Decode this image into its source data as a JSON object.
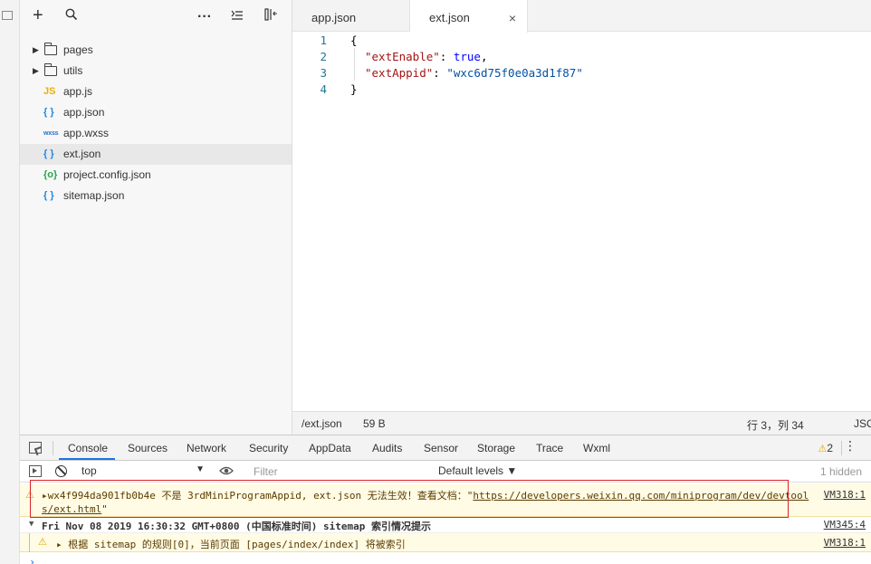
{
  "tree": {
    "toolbar": {
      "add_icon": "plus-icon",
      "search_icon": "search-icon",
      "more_icon": "ellipsis-icon",
      "collapse_icon": "list-collapse-icon",
      "layout_icon": "layout-icon"
    },
    "items": [
      {
        "label": "pages",
        "type": "folder"
      },
      {
        "label": "utils",
        "type": "folder"
      },
      {
        "label": "app.js",
        "type": "js",
        "icon": "JS"
      },
      {
        "label": "app.json",
        "type": "json",
        "icon": "{ }"
      },
      {
        "label": "app.wxss",
        "type": "wxss",
        "icon": "wxss"
      },
      {
        "label": "ext.json",
        "type": "json",
        "icon": "{ }",
        "selected": true
      },
      {
        "label": "project.config.json",
        "type": "config",
        "icon": "{o}"
      },
      {
        "label": "sitemap.json",
        "type": "json",
        "icon": "{ }"
      }
    ]
  },
  "editor": {
    "tabs": [
      {
        "label": "app.json"
      },
      {
        "label": "ext.json",
        "active": true,
        "close": "×"
      }
    ],
    "lines": [
      {
        "n": "1",
        "text": "{"
      },
      {
        "n": "2",
        "key": "\"extEnable\"",
        "sep": ": ",
        "val": "true",
        "end": ","
      },
      {
        "n": "3",
        "key": "\"extAppid\"",
        "sep": ": ",
        "val": "\"wxc6d75f0e0a3d1f87\"",
        "end": ""
      },
      {
        "n": "4",
        "text": "}"
      }
    ],
    "status": {
      "path": "/ext.json",
      "size": "59 B",
      "position": "行 3，列 34",
      "lang": "JSON"
    }
  },
  "devtools": {
    "tabs": [
      "Console",
      "Sources",
      "Network",
      "Security",
      "AppData",
      "Audits",
      "Sensor",
      "Storage",
      "Trace",
      "Wxml"
    ],
    "active_tab": "Console",
    "warning_count": "2",
    "context": "top",
    "filter_placeholder": "Filter",
    "levels": "Default levels ▼",
    "hidden": "1 hidden",
    "messages": [
      {
        "text_prefix": "▸wx4f994da901fb0b4e 不是 3rdMiniProgramAppid, ext.json 无法生效！查看文档：\"",
        "link": "https://developers.weixin.qq.com/miniprogram/dev/devtools/ext.html",
        "text_suffix": "\"",
        "source": "VM318:1"
      },
      {
        "text": "Fri Nov 08 2019 16:30:32 GMT+0800 (中国标准时间) sitemap 索引情况提示",
        "source": "VM345:4"
      },
      {
        "text": "▸ 根据 sitemap 的规则[0]，当前页面 [pages/index/index] 将被索引",
        "source": "VM318:1"
      }
    ],
    "prompt": "›"
  },
  "colors": {
    "accent": "#1a73e8",
    "warning_bg": "#fffbe5",
    "warning_icon": "#e0a800",
    "highlight_border": "#d9242a"
  }
}
